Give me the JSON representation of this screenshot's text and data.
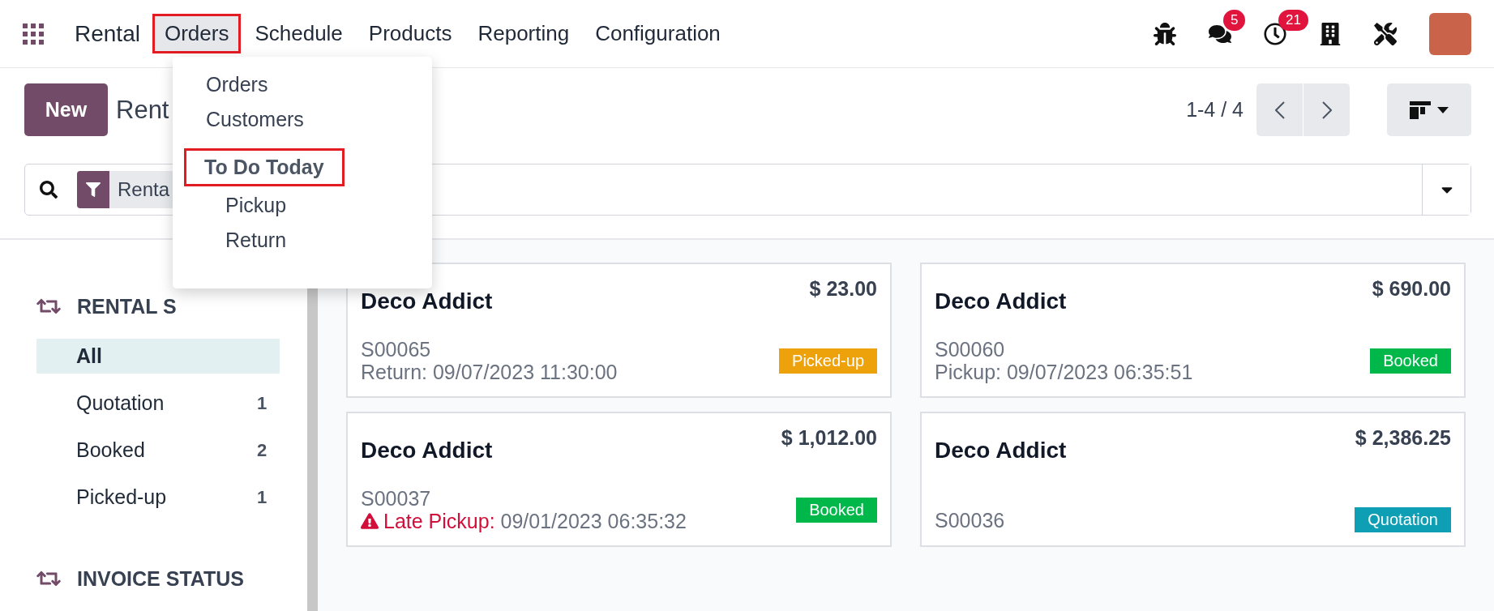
{
  "navbar": {
    "app": "Rental",
    "menus": [
      {
        "label": "Orders",
        "open": true,
        "highlighted": true
      },
      {
        "label": "Schedule",
        "open": false,
        "highlighted": false
      },
      {
        "label": "Products",
        "open": false,
        "highlighted": false
      },
      {
        "label": "Reporting",
        "open": false,
        "highlighted": false
      },
      {
        "label": "Configuration",
        "open": false,
        "highlighted": false
      }
    ],
    "systray": [
      {
        "kind": "bug"
      },
      {
        "kind": "chat",
        "badge": "5"
      },
      {
        "kind": "activity",
        "badge": "21"
      },
      {
        "kind": "company"
      },
      {
        "kind": "tools"
      },
      {
        "kind": "avatar"
      }
    ]
  },
  "dropdown": [
    {
      "kind": "item",
      "label": "Orders",
      "highlighted": false
    },
    {
      "kind": "item",
      "label": "Customers",
      "highlighted": false
    },
    {
      "kind": "header",
      "label": "To Do Today",
      "highlighted": true
    },
    {
      "kind": "subitem",
      "label": "Pickup",
      "highlighted": false
    },
    {
      "kind": "subitem",
      "label": "Return",
      "highlighted": false
    }
  ],
  "control_panel": {
    "new_button": "New",
    "title": "Rent",
    "pager": "1-4 / 4",
    "search": {
      "facet": "Renta"
    }
  },
  "sidebar": [
    {
      "title": "RENTAL S",
      "items": [
        {
          "label": "All",
          "selected": true
        },
        {
          "label": "Quotation",
          "count": "1",
          "selected": false
        },
        {
          "label": "Booked",
          "count": "2",
          "selected": false
        },
        {
          "label": "Picked-up",
          "count": "1",
          "selected": false
        }
      ]
    },
    {
      "title": "INVOICE STATUS"
    }
  ],
  "cards": [
    {
      "customer": "Deco Addict",
      "amount": "$ 23.00",
      "ref": "S00065",
      "schedule": {
        "late": false,
        "label": "Return:",
        "value": "09/07/2023 11:30:00"
      },
      "tag": {
        "label": "Picked-up",
        "color": "#eda10a"
      }
    },
    {
      "customer": "Deco Addict",
      "amount": "$ 690.00",
      "ref": "S00060",
      "schedule": {
        "late": false,
        "label": "Pickup:",
        "value": "09/07/2023 06:35:51"
      },
      "tag": {
        "label": "Booked",
        "color": "#00b84a"
      }
    },
    {
      "customer": "Deco Addict",
      "amount": "$ 1,012.00",
      "ref": "S00037",
      "schedule": {
        "late": true,
        "label": "Late Pickup:",
        "value": "09/01/2023 06:35:32"
      },
      "tag": {
        "label": "Booked",
        "color": "#00b84a"
      }
    },
    {
      "customer": "Deco Addict",
      "amount": "$ 2,386.25",
      "ref": "S00036",
      "tag": {
        "label": "Quotation",
        "color": "#0f9fb5"
      }
    }
  ]
}
